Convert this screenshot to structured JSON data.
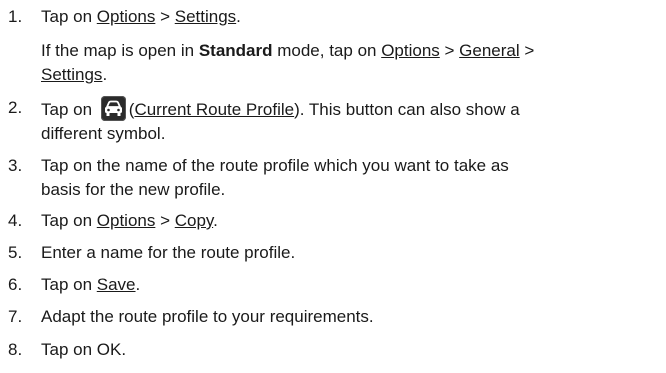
{
  "steps": [
    {
      "num": "1.",
      "s1_link1": "Options",
      "s1_sep": " > ",
      "s1_link2": "Settings",
      "s1_end": ".",
      "note_pre": "If the map is open in ",
      "note_bold": "Standard",
      "note_mid": " mode, tap on ",
      "note_link1": "Options",
      "note_sep1": " > ",
      "note_link2": "General",
      "note_sep2": " >",
      "note_link3": "Settings",
      "note_end": ".",
      "pre": "Tap on "
    },
    {
      "num": "2.",
      "pre": "Tap on ",
      "icon": "car-icon",
      "paren_open": "(",
      "link": "Current Route Profile",
      "post_line1": "). This button can also show a",
      "post_line2": "different symbol."
    },
    {
      "num": "3.",
      "line1": "Tap on the name of the route profile which you want to take as",
      "line2": "basis for the new profile."
    },
    {
      "num": "4.",
      "pre": "Tap on ",
      "link1": "Options",
      "sep": " > ",
      "link2": "Copy",
      "end": "."
    },
    {
      "num": "5.",
      "text": "Enter a name for the route profile."
    },
    {
      "num": "6.",
      "pre": "Tap on ",
      "link": "Save",
      "end": "."
    },
    {
      "num": "7.",
      "text": "Adapt the route profile to your requirements."
    },
    {
      "num": "8.",
      "text": "Tap on OK."
    }
  ]
}
